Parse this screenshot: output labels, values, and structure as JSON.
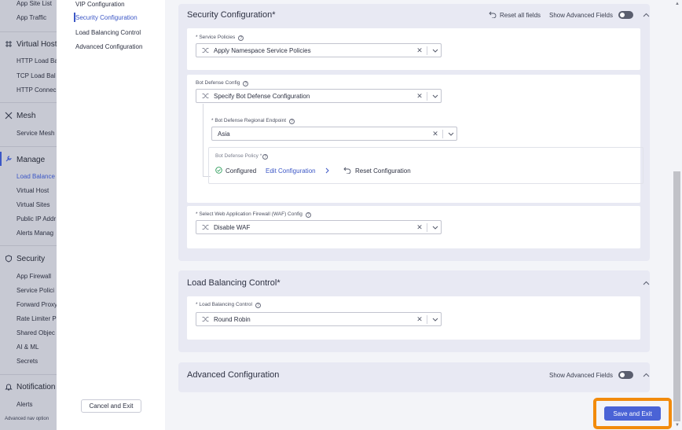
{
  "left_nav": {
    "items_top": [
      "App Site List",
      "App Traffic"
    ],
    "groups": [
      {
        "label": "Virtual Host",
        "items": [
          "HTTP Load Ba",
          "TCP Load Bal",
          "HTTP Connec"
        ]
      },
      {
        "label": "Mesh",
        "items": [
          "Service Mesh"
        ]
      },
      {
        "label": "Manage",
        "items": [
          "Load Balance",
          "Virtual Host",
          "Virtual Sites",
          "Public IP Addr",
          "Alerts Manag"
        ]
      },
      {
        "label": "Security",
        "items": [
          "App Firewall",
          "Service Polici",
          "Forward Proxy",
          "Rate Limiter P",
          "Shared Objec",
          "AI & ML",
          "Secrets"
        ]
      },
      {
        "label": "Notification",
        "items": [
          "Alerts"
        ]
      }
    ],
    "footnote": "Advanced nav option"
  },
  "toc": {
    "items": [
      "VIP Configuration",
      "Security Configuration",
      "Load Balancing Control",
      "Advanced Configuration"
    ],
    "cancel_label": "Cancel and Exit"
  },
  "security_section": {
    "title": "Security Configuration",
    "required_mark": "*",
    "reset_label": "Reset all fields",
    "show_advanced_label": "Show Advanced Fields",
    "service_policies": {
      "label": "Service Policies",
      "required": "*",
      "value": "Apply Namespace Service Policies"
    },
    "bot_defense_config": {
      "label": "Bot Defense Config",
      "value": "Specify Bot Defense Configuration"
    },
    "bot_defense_endpoint": {
      "label": "Bot Defense Regional Endpoint",
      "required": "*",
      "value": "Asia"
    },
    "bot_defense_policy": {
      "label": "Bot Defense Policy",
      "required": "*",
      "status": "Configured",
      "edit_label": "Edit Configuration",
      "reset_label": "Reset Configuration"
    },
    "waf": {
      "label": "Select Web Application Firewall (WAF) Config",
      "required": "*",
      "value": "Disable WAF"
    }
  },
  "lb_section": {
    "title": "Load Balancing Control",
    "required_mark": "*",
    "field": {
      "label": "Load Balancing Control",
      "required": "*",
      "value": "Round Robin"
    }
  },
  "advanced_section": {
    "title": "Advanced Configuration",
    "show_advanced_label": "Show Advanced Fields"
  },
  "save_label": "Save and Exit",
  "colors": {
    "accent": "#4a63d6",
    "highlight": "#f28b0c",
    "link": "#3c57c6"
  }
}
